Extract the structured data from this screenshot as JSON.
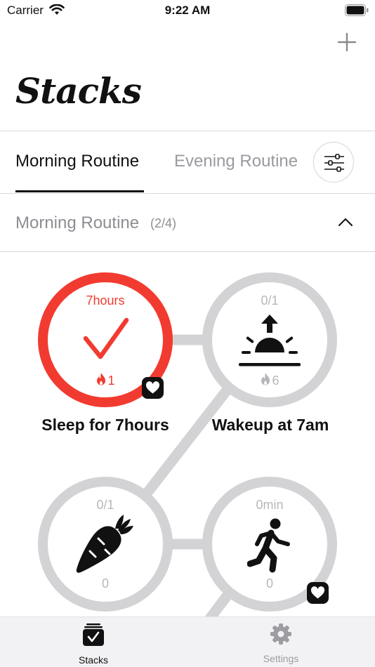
{
  "status_bar": {
    "carrier": "Carrier",
    "time": "9:22 AM"
  },
  "header": {
    "logo_text": "Stacks",
    "add_icon": "plus-icon"
  },
  "tabs": [
    {
      "label": "Morning Routine",
      "selected": true
    },
    {
      "label": "Evening Routine",
      "selected": false
    }
  ],
  "filter_icon": "sliders-icon",
  "section": {
    "title": "Morning Routine",
    "count": "(2/4)",
    "expanded": true
  },
  "habits": [
    {
      "name": "Sleep for 7hours",
      "progress": "7hours",
      "streak": "1",
      "completed": true,
      "icon": "checkmark-icon",
      "health_badge": true
    },
    {
      "name": "Wakeup at 7am",
      "progress": "0/1",
      "streak": "6",
      "completed": false,
      "icon": "sunrise-icon",
      "health_badge": false
    },
    {
      "name": "",
      "progress": "0/1",
      "streak": "0",
      "completed": false,
      "icon": "carrot-icon",
      "health_badge": false
    },
    {
      "name": "",
      "progress": "0min",
      "streak": "0",
      "completed": false,
      "icon": "runner-icon",
      "health_badge": true
    }
  ],
  "colors": {
    "accent": "#f23b30",
    "ring_idle": "#d3d3d6",
    "text_muted": "#8d8d93"
  },
  "tabbar": [
    {
      "label": "Stacks",
      "icon": "stack-check-icon",
      "selected": true
    },
    {
      "label": "Settings",
      "icon": "gear-icon",
      "selected": false
    }
  ]
}
